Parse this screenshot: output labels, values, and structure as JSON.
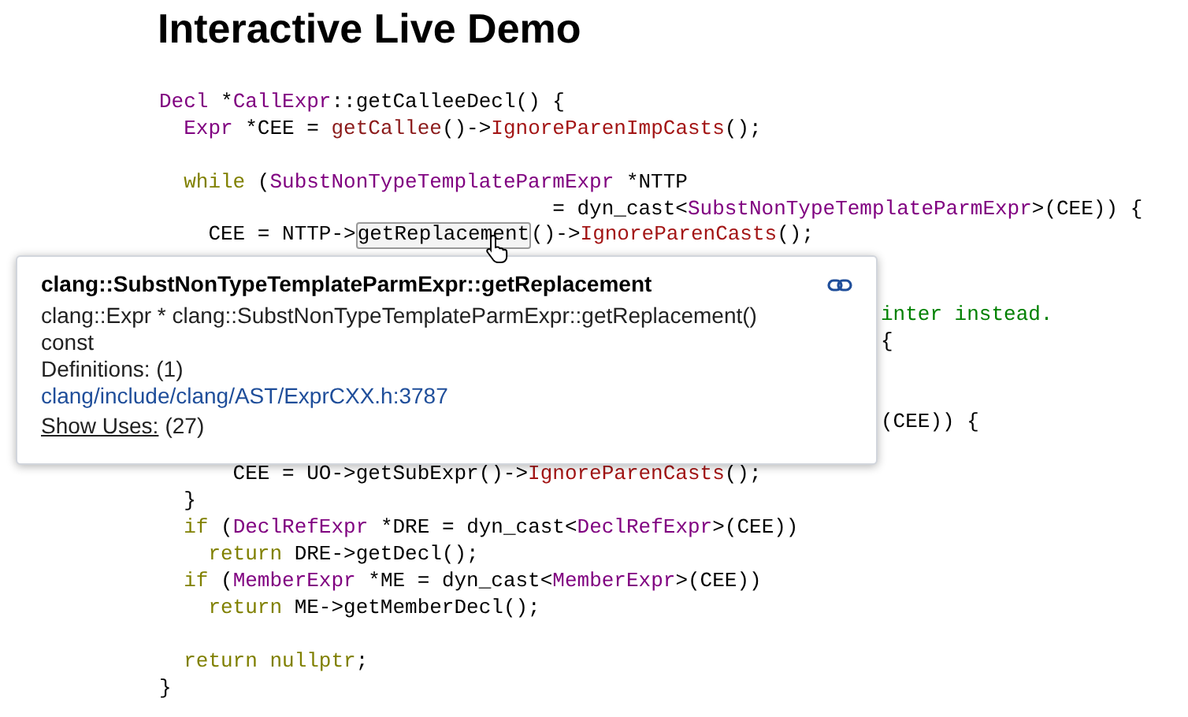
{
  "title": "Interactive Live Demo",
  "code": [
    {
      "kind": "code",
      "segments": [
        {
          "t": "Decl",
          "kind": "type"
        },
        {
          "t": " *",
          "kind": "plain"
        },
        {
          "t": "CallExpr",
          "kind": "type"
        },
        {
          "t": "::getCalleeDecl() {",
          "kind": "plain"
        }
      ]
    },
    {
      "kind": "code",
      "segments": [
        {
          "t": "  Expr",
          "kind": "type"
        },
        {
          "t": " *CEE = ",
          "kind": "plain"
        },
        {
          "t": "getCallee",
          "kind": "call"
        },
        {
          "t": "()->",
          "kind": "plain"
        },
        {
          "t": "IgnoreParenImpCasts",
          "kind": "method"
        },
        {
          "t": "();",
          "kind": "plain"
        }
      ]
    },
    {
      "kind": "blank"
    },
    {
      "kind": "code",
      "segments": [
        {
          "t": "  while",
          "kind": "keyword"
        },
        {
          "t": " (",
          "kind": "plain"
        },
        {
          "t": "SubstNonTypeTemplateParmExpr",
          "kind": "type"
        },
        {
          "t": " *NTTP",
          "kind": "plain"
        }
      ]
    },
    {
      "kind": "code",
      "segments": [
        {
          "t": "                                = dyn_cast<",
          "kind": "plain"
        },
        {
          "t": "SubstNonTypeTemplateParmExpr",
          "kind": "type"
        },
        {
          "t": ">(CEE)) {",
          "kind": "plain"
        }
      ]
    },
    {
      "kind": "code",
      "segments": [
        {
          "t": "    CEE = NTTP->",
          "kind": "plain"
        },
        {
          "t": "getReplacement",
          "kind": "hovered"
        },
        {
          "t": "()->",
          "kind": "plain"
        },
        {
          "t": "IgnoreParenCasts",
          "kind": "method"
        },
        {
          "t": "();",
          "kind": "plain"
        }
      ]
    },
    {
      "kind": "covered"
    },
    {
      "kind": "covered"
    },
    {
      "kind": "covered",
      "segments": [
        {
          "t": "inter instead.",
          "kind": "comment"
        }
      ]
    },
    {
      "kind": "covered",
      "segments": [
        {
          "t": "{",
          "kind": "plain"
        }
      ]
    },
    {
      "kind": "covered"
    },
    {
      "kind": "covered"
    },
    {
      "kind": "covered",
      "segments": [
        {
          "t": "(CEE)) {",
          "kind": "plain"
        }
      ]
    },
    {
      "kind": "covered"
    },
    {
      "kind": "code",
      "segments": [
        {
          "t": "      CEE = UO->getSubExpr()->",
          "kind": "plain"
        },
        {
          "t": "IgnoreParenCasts",
          "kind": "method"
        },
        {
          "t": "();",
          "kind": "plain"
        }
      ]
    },
    {
      "kind": "code",
      "segments": [
        {
          "t": "  }",
          "kind": "plain"
        }
      ]
    },
    {
      "kind": "code",
      "segments": [
        {
          "t": "  if",
          "kind": "keyword"
        },
        {
          "t": " (",
          "kind": "plain"
        },
        {
          "t": "DeclRefExpr",
          "kind": "type"
        },
        {
          "t": " *DRE = dyn_cast<",
          "kind": "plain"
        },
        {
          "t": "DeclRefExpr",
          "kind": "type"
        },
        {
          "t": ">(CEE))",
          "kind": "plain"
        }
      ]
    },
    {
      "kind": "code",
      "segments": [
        {
          "t": "    return",
          "kind": "keyword"
        },
        {
          "t": " DRE->getDecl();",
          "kind": "plain"
        }
      ]
    },
    {
      "kind": "code",
      "segments": [
        {
          "t": "  if",
          "kind": "keyword"
        },
        {
          "t": " (",
          "kind": "plain"
        },
        {
          "t": "MemberExpr",
          "kind": "type"
        },
        {
          "t": " *ME = dyn_cast<",
          "kind": "plain"
        },
        {
          "t": "MemberExpr",
          "kind": "type"
        },
        {
          "t": ">(CEE))",
          "kind": "plain"
        }
      ]
    },
    {
      "kind": "code",
      "segments": [
        {
          "t": "    return",
          "kind": "keyword"
        },
        {
          "t": " ME->getMemberDecl();",
          "kind": "plain"
        }
      ]
    },
    {
      "kind": "blank"
    },
    {
      "kind": "code",
      "segments": [
        {
          "t": "  return nullptr",
          "kind": "keyword"
        },
        {
          "t": ";",
          "kind": "plain"
        }
      ]
    },
    {
      "kind": "code",
      "segments": [
        {
          "t": "}",
          "kind": "plain"
        }
      ]
    }
  ],
  "tooltip": {
    "title": "clang::SubstNonTypeTemplateParmExpr::getReplacement",
    "signature": "clang::Expr * clang::SubstNonTypeTemplateParmExpr::getReplacement() const",
    "definitions": "Definitions: (1)",
    "definition_link": "clang/include/clang/AST/ExprCXX.h:3787",
    "uses_link": "Show Uses:",
    "uses_count": "(27)"
  }
}
